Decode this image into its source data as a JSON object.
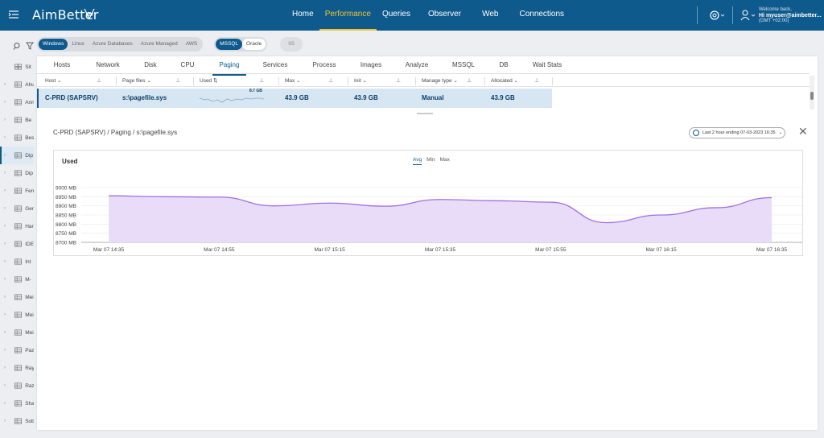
{
  "app": {
    "brand": "AimBetter",
    "nav": [
      "Home",
      "Performance",
      "Queries",
      "Observer",
      "Web",
      "Connections"
    ],
    "active_nav": "Performance",
    "welcome": "Welcome back,",
    "user": "Hi myuser@aimbetter...",
    "timezone": "(GMT +02:00)"
  },
  "sidebar": {
    "items": [
      "Sit",
      "Ahu",
      "Ann",
      "Be",
      "Bes",
      "Dip",
      "Dip",
      "Fen",
      "Gen",
      "Har",
      "IDE",
      "Int",
      "M-",
      "Mei",
      "Mei",
      "Mei",
      "Paz",
      "Ray",
      "Raz",
      "Sha",
      "Sob"
    ]
  },
  "filters": {
    "os": [
      "Windows",
      "Linux",
      "Azure Databases",
      "Azure Managed",
      "AWS"
    ],
    "db": [
      "MSSQL",
      "Oracle"
    ],
    "other": [
      "IIS"
    ]
  },
  "tabs": [
    "Hosts",
    "Network",
    "Disk",
    "CPU",
    "Paging",
    "Services",
    "Process",
    "Images",
    "Analyze",
    "MSSQL",
    "DB",
    "Wait Stats"
  ],
  "table": {
    "headers": [
      "Host",
      "Page files",
      "Used",
      "Max",
      "Init",
      "Manage type",
      "Allocated"
    ],
    "row": {
      "host": "C-PRD (SAPSRV)",
      "page_file": "s:\\pagefile.sys",
      "used_spark_label": "8.7 GB",
      "max": "43.9 GB",
      "init": "43.9 GB",
      "manage_type": "Manual",
      "allocated": "43.9 GB"
    }
  },
  "detail": {
    "breadcrumb": "C-PRD (SAPSRV) / Paging / s:\\pagefile.sys",
    "range": "Last 2 hour ending  07-03-2023 16:35",
    "agg_tabs": [
      "Avg",
      "Min",
      "Max"
    ],
    "active_agg": "Avg"
  },
  "colors": {
    "brand": "#0f5a8c",
    "accent": "#f2c230",
    "series": "#a070e0"
  },
  "chart_data": {
    "type": "area",
    "title": "Used",
    "x": [
      "Mar 07 14:35",
      "Mar 07 14:45",
      "Mar 07 14:55",
      "Mar 07 15:05",
      "Mar 07 15:15",
      "Mar 07 15:25",
      "Mar 07 15:35",
      "Mar 07 15:45",
      "Mar 07 15:55",
      "Mar 07 16:05",
      "Mar 07 16:15",
      "Mar 07 16:25",
      "Mar 07 16:35"
    ],
    "x_ticks": [
      "Mar 07 14:35",
      "Mar 07 14:55",
      "Mar 07 15:15",
      "Mar 07 15:35",
      "Mar 07 15:55",
      "Mar 07 16:15",
      "Mar 07 16:35"
    ],
    "series": [
      {
        "values": [
          8955,
          8950,
          8948,
          8900,
          8915,
          8898,
          8935,
          8928,
          8920,
          8808,
          8850,
          8890,
          8945
        ]
      }
    ],
    "y_ticks": [
      "9000 MB",
      "8950 MB",
      "8900 MB",
      "8850 MB",
      "8800 MB",
      "8750 MB",
      "8700 MB"
    ],
    "ylim": [
      8700,
      9000
    ],
    "grid": true
  }
}
